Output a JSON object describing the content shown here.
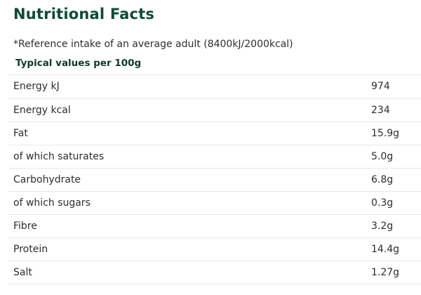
{
  "title": "Nutritional Facts",
  "reference_note": "*Reference intake of an average adult (8400kJ/2000kcal)",
  "typical_values_label": "Typical values per 100g",
  "nutrients": [
    {
      "name": "Energy kJ",
      "value": "974"
    },
    {
      "name": "Energy kcal",
      "value": "234"
    },
    {
      "name": "Fat",
      "value": "15.9g"
    },
    {
      "name": "of which saturates",
      "value": "5.0g"
    },
    {
      "name": "Carbohydrate",
      "value": "6.8g"
    },
    {
      "name": "of which sugars",
      "value": "0.3g"
    },
    {
      "name": "Fibre",
      "value": "3.2g"
    },
    {
      "name": "Protein",
      "value": "14.4g"
    },
    {
      "name": "Salt",
      "value": "1.27g"
    }
  ],
  "colors": {
    "title": "#0f4a34",
    "text": "#2a2e2c",
    "divider": "#e6e8e7"
  }
}
